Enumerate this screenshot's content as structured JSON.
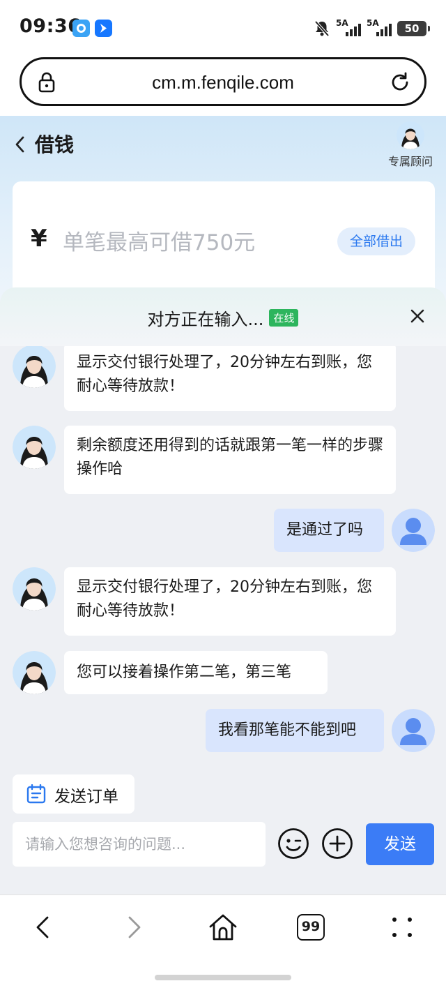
{
  "status_bar": {
    "time": "09:36",
    "signal1_label": "5A",
    "signal2_label": "5A",
    "battery": "50"
  },
  "browser": {
    "url": "cm.m.fenqile.com"
  },
  "header": {
    "title": "借钱",
    "advisor_label": "专属顾问"
  },
  "amount_card": {
    "currency_symbol": "¥",
    "placeholder": "单笔最高可借750元",
    "borrow_all_label": "全部借出"
  },
  "chat": {
    "title": "对方正在输入...",
    "status_badge": "在线",
    "messages": [
      {
        "from": "agent",
        "text": "显示交付银行处理了，20分钟左右到账，您耐心等待放款！"
      },
      {
        "from": "agent",
        "text": "剩余额度还用得到的话就跟第一笔一样的步骤操作哈"
      },
      {
        "from": "user",
        "text": "是通过了吗"
      },
      {
        "from": "agent",
        "text": "显示交付银行处理了，20分钟左右到账，您耐心等待放款！"
      },
      {
        "from": "agent",
        "text": "您可以接着操作第二笔，第三笔"
      },
      {
        "from": "user",
        "text": "我看那笔能不能到吧"
      }
    ],
    "send_order_label": "发送订单",
    "input_placeholder": "请输入您想咨询的问题...",
    "send_label": "发送"
  },
  "bottom_nav": {
    "tabs_count": "99"
  },
  "colors": {
    "accent": "#3b7cf6",
    "online": "#2db55d",
    "user_bubble": "#d9e5fd"
  }
}
